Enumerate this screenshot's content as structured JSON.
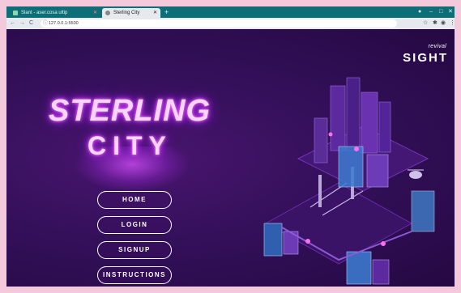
{
  "browser": {
    "tabs": [
      {
        "label": "Slant - aser.cosa ultip",
        "active": false
      },
      {
        "label": "Sterling City",
        "active": true
      }
    ],
    "new_tab": "+",
    "window_controls": {
      "minimize": "–",
      "maximize": "□",
      "close": "✕"
    },
    "address": "127.0.0.1:5500",
    "nav": {
      "back": "←",
      "forward": "→",
      "reload": "C"
    },
    "extensions": {
      "star": "☆",
      "puzzle": "✱",
      "menu": "⋮"
    }
  },
  "brand": {
    "top": "revival",
    "main": "SIGHT"
  },
  "title": {
    "line1": "STERLING",
    "line2": "CITY"
  },
  "menu": [
    {
      "label": "HOME"
    },
    {
      "label": "LOGIN"
    },
    {
      "label": "SIGNUP"
    },
    {
      "label": "INSTRUCTIONS"
    }
  ],
  "colors": {
    "neon": "#d43cff",
    "background": "#34105a",
    "tabbar": "#0d6e78",
    "frame": "#f5c9dc"
  }
}
